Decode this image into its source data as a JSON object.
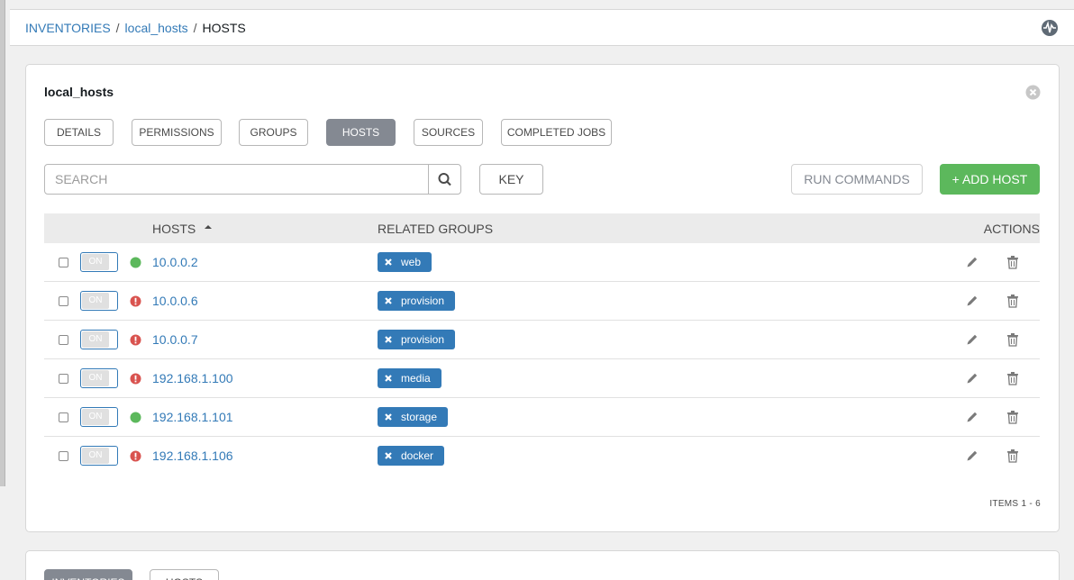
{
  "breadcrumb": {
    "inventories": "INVENTORIES",
    "inventory": "local_hosts",
    "current": "HOSTS",
    "sep": "/"
  },
  "panel": {
    "title": "local_hosts",
    "tabs": [
      {
        "label": "DETAILS",
        "active": false
      },
      {
        "label": "PERMISSIONS",
        "active": false
      },
      {
        "label": "GROUPS",
        "active": false
      },
      {
        "label": "HOSTS",
        "active": true
      },
      {
        "label": "SOURCES",
        "active": false
      },
      {
        "label": "COMPLETED JOBS",
        "active": false
      }
    ],
    "search_placeholder": "SEARCH",
    "key_label": "KEY",
    "run_commands_label": "RUN COMMANDS",
    "add_host_label": "+ ADD HOST",
    "columns": {
      "hosts": "HOSTS",
      "groups": "RELATED GROUPS",
      "actions": "ACTIONS"
    },
    "rows": [
      {
        "toggle": "ON",
        "status": "ok",
        "host": "10.0.0.2",
        "group": "web"
      },
      {
        "toggle": "ON",
        "status": "failed",
        "host": "10.0.0.6",
        "group": "provision"
      },
      {
        "toggle": "ON",
        "status": "failed",
        "host": "10.0.0.7",
        "group": "provision"
      },
      {
        "toggle": "ON",
        "status": "failed",
        "host": "192.168.1.100",
        "group": "media"
      },
      {
        "toggle": "ON",
        "status": "ok",
        "host": "192.168.1.101",
        "group": "storage"
      },
      {
        "toggle": "ON",
        "status": "failed",
        "host": "192.168.1.106",
        "group": "docker"
      }
    ],
    "items_count": "ITEMS  1 - 6"
  },
  "panel2": {
    "tabs": [
      "INVENTORIES",
      "HOSTS"
    ]
  },
  "colors": {
    "link": "#337ab7",
    "ok": "#5cb85c",
    "failed": "#d9534f",
    "active_tab": "#848992"
  }
}
